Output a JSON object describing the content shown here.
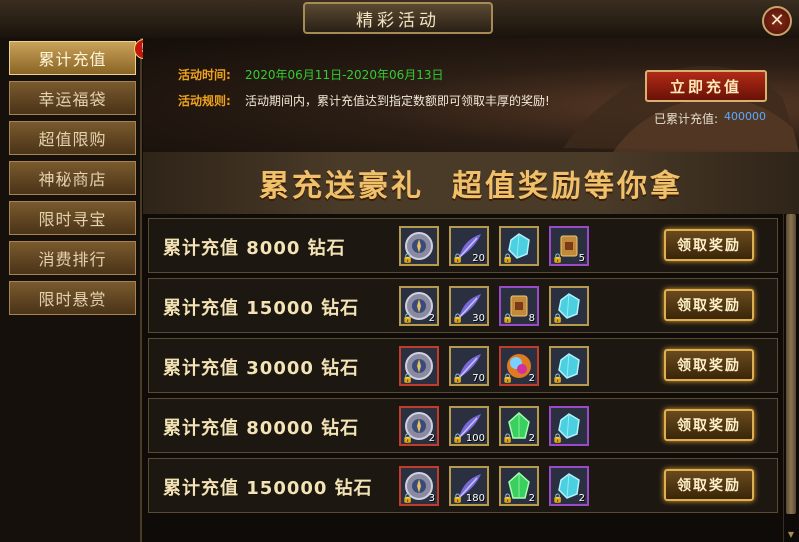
{
  "window": {
    "title": "精彩活动",
    "close_glyph": "✕"
  },
  "sidebar": {
    "items": [
      {
        "label": "累计充值",
        "active": true
      },
      {
        "label": "幸运福袋",
        "active": false
      },
      {
        "label": "超值限购",
        "active": false
      },
      {
        "label": "神秘商店",
        "active": false
      },
      {
        "label": "限时寻宝",
        "active": false
      },
      {
        "label": "消费排行",
        "active": false
      },
      {
        "label": "限时悬赏",
        "active": false
      }
    ],
    "badge": "!"
  },
  "banner": {
    "time_label": "活动时间:",
    "time_value": "2020年06月11日-2020年06月13日",
    "rule_label": "活动规则:",
    "rule_value": "活动期间内，累计充值达到指定数额即可领取丰厚的奖励!",
    "recharge_button": "立即充值",
    "total_label": "已累计充值:",
    "total_value": "400000"
  },
  "slogan": {
    "part1": "累充送豪礼",
    "part2": "超值奖励等你拿"
  },
  "tiers": [
    {
      "label": "累计充值  8000  钻石",
      "claim": "领取奖励",
      "items": [
        {
          "icon": "compass-icon",
          "qty": "",
          "frame": "gold"
        },
        {
          "icon": "feather-icon",
          "qty": "20",
          "frame": "gold"
        },
        {
          "icon": "crystal-icon",
          "qty": "",
          "frame": "gold"
        },
        {
          "icon": "scroll-icon",
          "qty": "5",
          "frame": "purple"
        }
      ]
    },
    {
      "label": "累计充值  15000  钻石",
      "claim": "领取奖励",
      "items": [
        {
          "icon": "compass-icon",
          "qty": "2",
          "frame": "gold"
        },
        {
          "icon": "feather-icon",
          "qty": "30",
          "frame": "gold"
        },
        {
          "icon": "scroll-icon",
          "qty": "8",
          "frame": "purple"
        },
        {
          "icon": "crystal-icon",
          "qty": "",
          "frame": "gold"
        }
      ]
    },
    {
      "label": "累计充值  30000  钻石",
      "claim": "领取奖励",
      "items": [
        {
          "icon": "compass-icon",
          "qty": "",
          "frame": "red"
        },
        {
          "icon": "feather-icon",
          "qty": "70",
          "frame": "gold"
        },
        {
          "icon": "orb-icon",
          "qty": "2",
          "frame": "red"
        },
        {
          "icon": "crystal-icon",
          "qty": "",
          "frame": "gold"
        }
      ]
    },
    {
      "label": "累计充值  80000  钻石",
      "claim": "领取奖励",
      "items": [
        {
          "icon": "compass-icon",
          "qty": "2",
          "frame": "red"
        },
        {
          "icon": "feather-icon",
          "qty": "100",
          "frame": "gold"
        },
        {
          "icon": "green-gem-icon",
          "qty": "2",
          "frame": "gold"
        },
        {
          "icon": "crystal-icon",
          "qty": "",
          "frame": "purple"
        }
      ]
    },
    {
      "label": "累计充值 150000 钻石",
      "claim": "领取奖励",
      "items": [
        {
          "icon": "compass-icon",
          "qty": "3",
          "frame": "red"
        },
        {
          "icon": "feather-icon",
          "qty": "180",
          "frame": "gold"
        },
        {
          "icon": "green-gem-icon",
          "qty": "2",
          "frame": "gold"
        },
        {
          "icon": "crystal-icon",
          "qty": "2",
          "frame": "purple"
        }
      ]
    }
  ],
  "colors": {
    "accent_gold": "#f0c06a",
    "info_label": "#f0a21c",
    "info_date": "#33cc33",
    "total_value": "#5aaaff"
  }
}
